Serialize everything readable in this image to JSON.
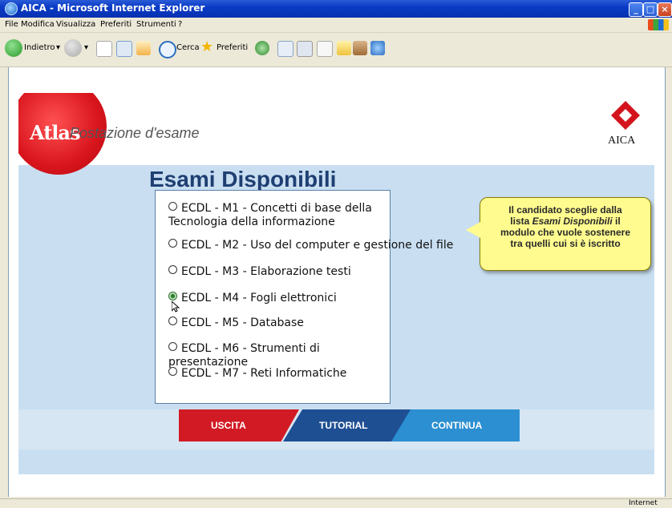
{
  "window": {
    "title": "AICA - Microsoft Internet Explorer"
  },
  "menu": [
    "File",
    "Modifica",
    "Visualizza",
    "Preferiti",
    "Strumenti",
    "?"
  ],
  "toolbar": {
    "back_label": "Indietro",
    "search_label": "Cerca",
    "favorites_label": "Preferiti"
  },
  "app": {
    "atlas_logo": "Atlas",
    "station_title": "Postazione d'esame",
    "aica_label": "AICA",
    "page_title": "Esami Disponibili",
    "exams": [
      {
        "label": "ECDL - M1 - Concetti di base della Tecnologia della informazione",
        "selected": false
      },
      {
        "label": "ECDL - M2 - Uso del computer e gestione del file",
        "selected": false
      },
      {
        "label": "ECDL - M3 - Elaborazione testi",
        "selected": false
      },
      {
        "label": "ECDL - M4 - Fogli elettronici",
        "selected": true
      },
      {
        "label": "ECDL - M5 - Database",
        "selected": false
      },
      {
        "label": "ECDL - M6 - Strumenti di presentazione",
        "selected": false
      },
      {
        "label": "ECDL - M7 - Reti Informatiche",
        "selected": false
      }
    ],
    "buttons": {
      "exit": "USCITA",
      "tutorial": "TUTORIAL",
      "continue": "CONTINUA"
    },
    "tooltip": {
      "line1": "Il candidato sceglie dalla",
      "line2_pre": "lista ",
      "line2_em": "Esami Disponibili",
      "line2_post": " il",
      "line3": "modulo che vuole sostenere",
      "line4": "tra quelli cui si è iscritto"
    }
  },
  "status": {
    "zone": "Internet"
  }
}
